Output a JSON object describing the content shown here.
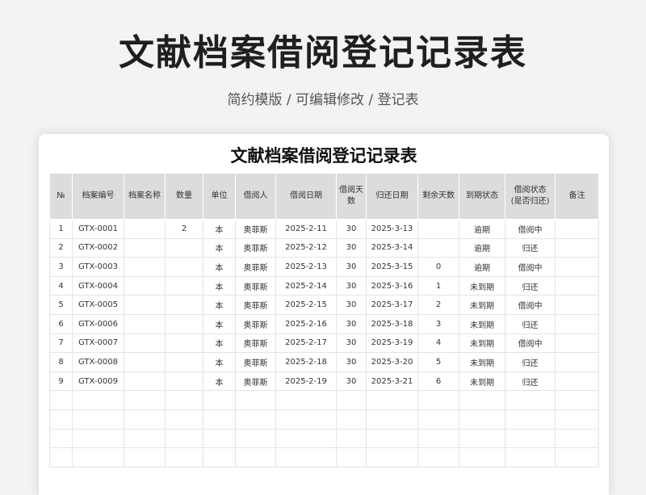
{
  "header": {
    "title": "文献档案借阅登记记录表",
    "subtitle": "简约模版 /  可编辑修改  / 登记表"
  },
  "sheet": {
    "title": "文献档案借阅登记记录表",
    "columns": [
      "№",
      "档案编号",
      "档案名称",
      "数量",
      "单位",
      "借阅人",
      "借阅日期",
      "借阅天数",
      "归还日期",
      "剩余天数",
      "到期状态",
      "借阅状态\n(是否归还)",
      "备注"
    ],
    "rows": [
      {
        "no": "1",
        "code": "GTX-0001",
        "name": "",
        "qty": "2",
        "unit": "本",
        "borrower": "奥菲斯",
        "borrow_date": "2025-2-11",
        "days": "30",
        "return_date": "2025-3-13",
        "remaining": "",
        "due_status": "逾期",
        "borrow_status": "借阅中",
        "note": ""
      },
      {
        "no": "2",
        "code": "GTX-0002",
        "name": "",
        "qty": "",
        "unit": "本",
        "borrower": "奥菲斯",
        "borrow_date": "2025-2-12",
        "days": "30",
        "return_date": "2025-3-14",
        "remaining": "",
        "due_status": "逾期",
        "borrow_status": "归还",
        "note": ""
      },
      {
        "no": "3",
        "code": "GTX-0003",
        "name": "",
        "qty": "",
        "unit": "本",
        "borrower": "奥菲斯",
        "borrow_date": "2025-2-13",
        "days": "30",
        "return_date": "2025-3-15",
        "remaining": "0",
        "due_status": "逾期",
        "borrow_status": "借阅中",
        "note": ""
      },
      {
        "no": "4",
        "code": "GTX-0004",
        "name": "",
        "qty": "",
        "unit": "本",
        "borrower": "奥菲斯",
        "borrow_date": "2025-2-14",
        "days": "30",
        "return_date": "2025-3-16",
        "remaining": "1",
        "due_status": "未到期",
        "borrow_status": "归还",
        "note": ""
      },
      {
        "no": "5",
        "code": "GTX-0005",
        "name": "",
        "qty": "",
        "unit": "本",
        "borrower": "奥菲斯",
        "borrow_date": "2025-2-15",
        "days": "30",
        "return_date": "2025-3-17",
        "remaining": "2",
        "due_status": "未到期",
        "borrow_status": "借阅中",
        "note": ""
      },
      {
        "no": "6",
        "code": "GTX-0006",
        "name": "",
        "qty": "",
        "unit": "本",
        "borrower": "奥菲斯",
        "borrow_date": "2025-2-16",
        "days": "30",
        "return_date": "2025-3-18",
        "remaining": "3",
        "due_status": "未到期",
        "borrow_status": "归还",
        "note": ""
      },
      {
        "no": "7",
        "code": "GTX-0007",
        "name": "",
        "qty": "",
        "unit": "本",
        "borrower": "奥菲斯",
        "borrow_date": "2025-2-17",
        "days": "30",
        "return_date": "2025-3-19",
        "remaining": "4",
        "due_status": "未到期",
        "borrow_status": "借阅中",
        "note": ""
      },
      {
        "no": "8",
        "code": "GTX-0008",
        "name": "",
        "qty": "",
        "unit": "本",
        "borrower": "奥菲斯",
        "borrow_date": "2025-2-18",
        "days": "30",
        "return_date": "2025-3-20",
        "remaining": "5",
        "due_status": "未到期",
        "borrow_status": "归还",
        "note": ""
      },
      {
        "no": "9",
        "code": "GTX-0009",
        "name": "",
        "qty": "",
        "unit": "本",
        "borrower": "奥菲斯",
        "borrow_date": "2025-2-19",
        "days": "30",
        "return_date": "2025-3-21",
        "remaining": "6",
        "due_status": "未到期",
        "borrow_status": "归还",
        "note": ""
      }
    ],
    "empty_rows": 4
  },
  "colors": {
    "overdue": "#c0392b",
    "borrowing": "#b8860b",
    "returned": "#3a8f3a",
    "header_bg": "#dcdcdc"
  }
}
